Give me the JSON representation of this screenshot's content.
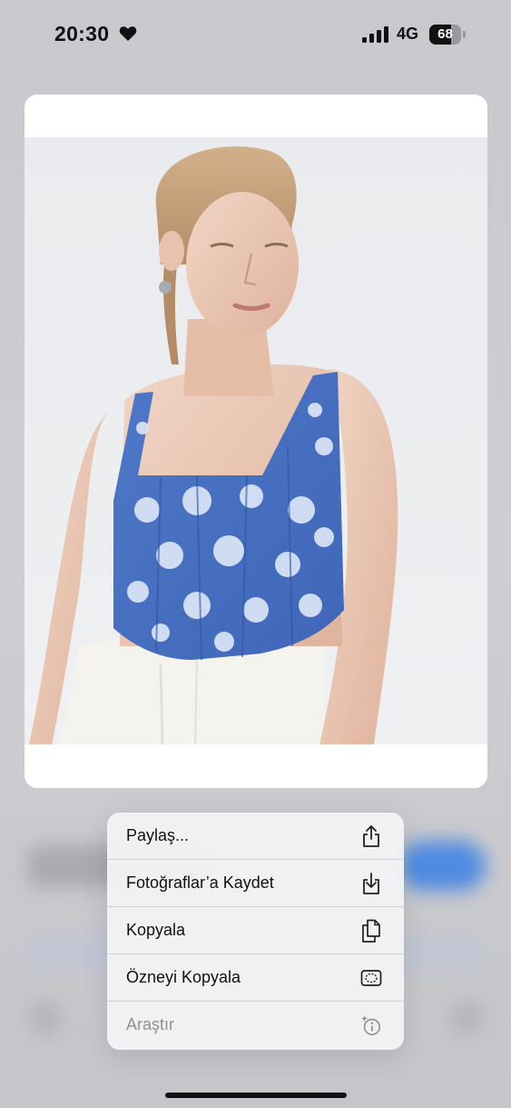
{
  "status_bar": {
    "time": "20:30",
    "status_icon": "heart-icon",
    "network": "4G",
    "battery_level": "68",
    "battery_fraction": 0.68
  },
  "image_card": {
    "photo": "model-in-floral-corset-top"
  },
  "context_menu": {
    "items": [
      {
        "label": "Paylaş...",
        "icon": "share-icon",
        "enabled": true
      },
      {
        "label": "Fotoğraflar’a Kaydet",
        "icon": "save-to-photos-icon",
        "enabled": true
      },
      {
        "label": "Kopyala",
        "icon": "copy-icon",
        "enabled": true
      },
      {
        "label": "Özneyi Kopyala",
        "icon": "copy-subject-icon",
        "enabled": true
      },
      {
        "label": "Araştır",
        "icon": "look-up-icon",
        "enabled": false
      }
    ]
  },
  "colors": {
    "menu_bg": "#f2f2f5",
    "text": "#111111",
    "disabled_text": "#8e8e93",
    "accent_blur": "#4f8be0"
  }
}
